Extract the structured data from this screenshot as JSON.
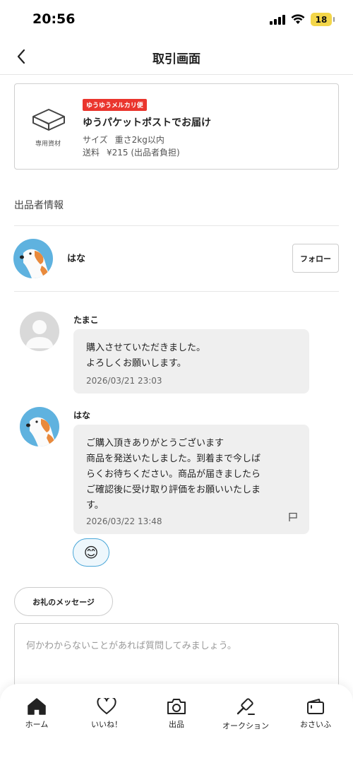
{
  "status_bar": {
    "time": "20:56",
    "battery": "18"
  },
  "nav": {
    "title": "取引画面"
  },
  "shipping": {
    "icon_label": "専用資材",
    "badge": "ゆうゆうメルカリ便",
    "title": "ゆうパケットポストでお届け",
    "size_label": "サイズ",
    "size_value": "重さ2kg以内",
    "fee_label": "送料",
    "fee_value": "¥215 (出品者負担)"
  },
  "seller_section": {
    "title": "出品者情報",
    "name": "はな",
    "follow_label": "フォロー"
  },
  "messages": [
    {
      "sender": "たまこ",
      "text": "購入させていただきました。\nよろしくお願いします。",
      "time": "2026/03/21 23:03"
    },
    {
      "sender": "はな",
      "text": "ご購入頂きありがとうございます\n商品を発送いたしました。到着まで今しば\nらくお待ちください。商品が届きましたら\nご確認後に受け取り評価をお願いいたしま\nす。",
      "time": "2026/03/22 13:48"
    }
  ],
  "reaction": {
    "emoji": "😊"
  },
  "thanks_button": {
    "label": "お礼のメッセージ"
  },
  "question_input": {
    "placeholder": "何かわからないことがあれば質問してみましょう。",
    "value": ""
  },
  "tabbar": {
    "items": [
      {
        "label": "ホーム",
        "icon": "home-icon"
      },
      {
        "label": "いいね！",
        "icon": "heart-icon"
      },
      {
        "label": "出品",
        "icon": "camera-icon"
      },
      {
        "label": "オークション",
        "icon": "gavel-icon"
      },
      {
        "label": "おさいふ",
        "icon": "wallet-icon"
      }
    ]
  }
}
